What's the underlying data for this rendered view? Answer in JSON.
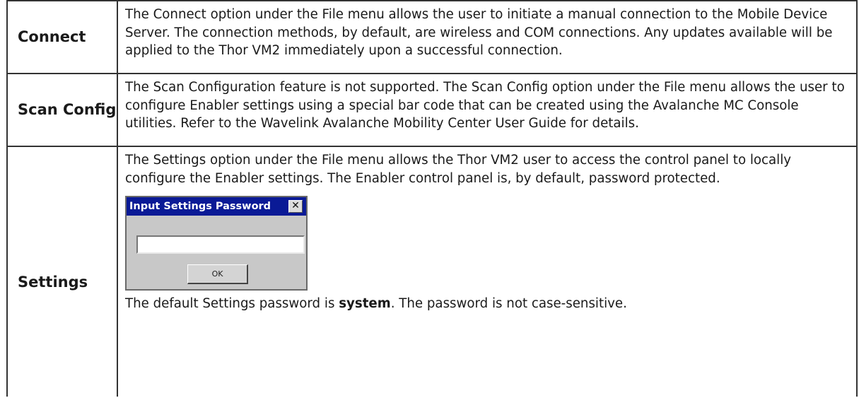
{
  "rows": [
    {
      "term": "Connect",
      "description": "The Connect option under the File menu allows the user to initiate a manual connection to the Mobile Device Server. The connection methods, by default, are wireless and COM connections. Any updates available will be applied to the Thor VM2 immediately upon a successful connection."
    },
    {
      "term": "Scan Config",
      "description": "The Scan Configuration feature is not supported. The Scan Config option under the File menu allows the user to configure Enabler settings using a special bar code that can be created using the Avalanche MC Console utilities. Refer to the Wavelink Avalanche Mobility Center User Guide for details."
    },
    {
      "term": "Settings",
      "description": "The Settings option under the File menu allows the Thor VM2 user to access the control panel to locally configure the Enabler settings. The Enabler control panel is, by default, password protected.",
      "dialog": {
        "title": "Input Settings Password",
        "close_symbol": "✕",
        "input_value": "",
        "ok_label": "OK"
      },
      "note_prefix": "The default Settings password is ",
      "note_password": "system",
      "note_suffix": ". The password is not case-sensitive."
    }
  ]
}
